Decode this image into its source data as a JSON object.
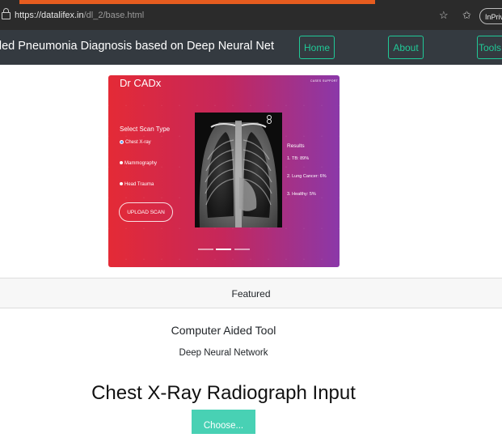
{
  "browser": {
    "url_host": "https://datalifex.in",
    "url_path": "/dl_2/base.html",
    "inprivate_label": "InPriva"
  },
  "navbar": {
    "brand": "ded Pneumonia Diagnosis based on Deep Neural Net",
    "links": [
      {
        "label": "Home"
      },
      {
        "label": "About"
      },
      {
        "label": "Tools"
      }
    ]
  },
  "hero": {
    "logo": "Dr CADx",
    "nav_items": [
      "CASES",
      "SUPPORT"
    ],
    "select_title": "Select Scan Type",
    "options": [
      {
        "label": "Chest X-ray",
        "selected": true
      },
      {
        "label": "Mammography",
        "selected": false
      },
      {
        "label": "Head Trauma",
        "selected": false
      }
    ],
    "upload_label": "UPLOAD SCAN",
    "results_title": "Results",
    "results": [
      "1. TB: 89%",
      "2. Lung Cancer: 6%",
      "3. Healthy: 5%"
    ],
    "carousel_active_index": 1
  },
  "featured": {
    "label": "Featured"
  },
  "card": {
    "title": "Computer Aided Tool",
    "subtitle": "Deep Neural Network"
  },
  "section": {
    "title": "Chest X-Ray Radiograph Input",
    "choose_label": "Choose..."
  },
  "colors": {
    "navbar": "#343a40",
    "accent": "#20c997",
    "hero_left": "#e42a36",
    "hero_right": "#8b38a9",
    "choose_button": "#48d1b4"
  }
}
